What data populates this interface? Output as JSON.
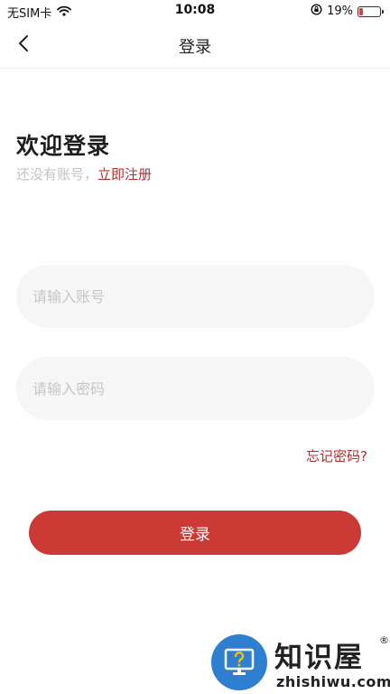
{
  "status_bar": {
    "carrier": "无SIM卡",
    "time": "10:08",
    "battery_percent": "19%",
    "battery_level": 0.19,
    "icons": [
      "wifi-icon",
      "orientation-lock-icon",
      "battery-icon"
    ]
  },
  "nav": {
    "title": "登录",
    "back_icon": "chevron-left-icon"
  },
  "welcome": {
    "title": "欢迎登录",
    "no_account_text": "还没有账号，",
    "register_link": "立即注册"
  },
  "form": {
    "account_placeholder": "请输入账号",
    "account_value": "",
    "password_placeholder": "请输入密码",
    "password_value": "",
    "forgot_password": "忘记密码?",
    "login_button": "登录"
  },
  "watermark": {
    "brand": "知识屋",
    "registered_mark": "®",
    "domain": "zhishiwu.com"
  },
  "colors": {
    "accent": "#cc3a36",
    "link": "#b52d2d",
    "input_bg": "#f5f6f5",
    "placeholder": "#c6c6c6",
    "watermark_blue": "#2f7fd0"
  }
}
